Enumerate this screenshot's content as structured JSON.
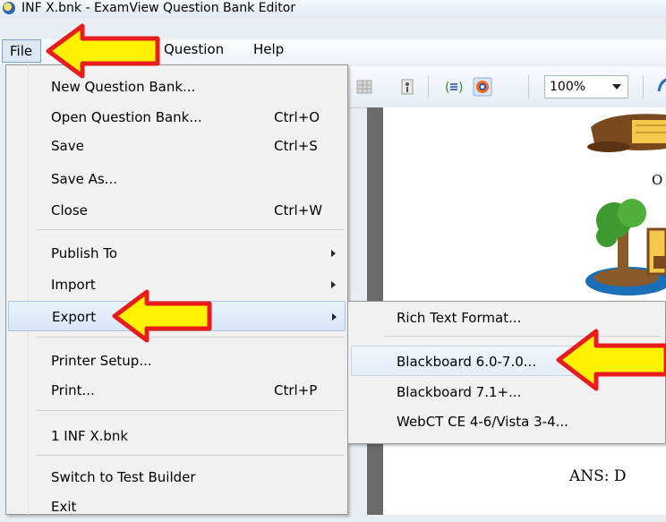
{
  "window": {
    "title": "INF X.bnk - ExamView Question Bank Editor"
  },
  "menubar": {
    "file": "File",
    "question": "Question",
    "help": "Help"
  },
  "toolbar": {
    "zoom": "100%"
  },
  "file_menu": {
    "items": [
      {
        "label": "New Question Bank...",
        "shortcut": ""
      },
      {
        "label": "Open Question Bank...",
        "shortcut": "Ctrl+O"
      },
      {
        "label": "Save",
        "shortcut": "Ctrl+S"
      },
      {
        "label": "Save As...",
        "shortcut": ""
      },
      {
        "label": "Close",
        "shortcut": "Ctrl+W"
      },
      {
        "label": "Publish To",
        "shortcut": ""
      },
      {
        "label": "Import",
        "shortcut": ""
      },
      {
        "label": "Export",
        "shortcut": ""
      },
      {
        "label": "Printer Setup...",
        "shortcut": ""
      },
      {
        "label": "Print...",
        "shortcut": "Ctrl+P"
      },
      {
        "label": "1 INF X.bnk",
        "shortcut": ""
      },
      {
        "label": "Switch to Test Builder",
        "shortcut": ""
      },
      {
        "label": "Exit",
        "shortcut": ""
      }
    ]
  },
  "export_submenu": {
    "items": [
      {
        "label": "Rich Text Format..."
      },
      {
        "label": "Blackboard 6.0-7.0..."
      },
      {
        "label": "Blackboard 7.1+..."
      },
      {
        "label": "WebCT CE 4-6/Vista 3-4..."
      }
    ]
  },
  "document": {
    "letter": "O",
    "answer": "ANS:  D"
  },
  "colors": {
    "arrow_fill": "#fff200",
    "arrow_outline": "#e81c1c"
  }
}
